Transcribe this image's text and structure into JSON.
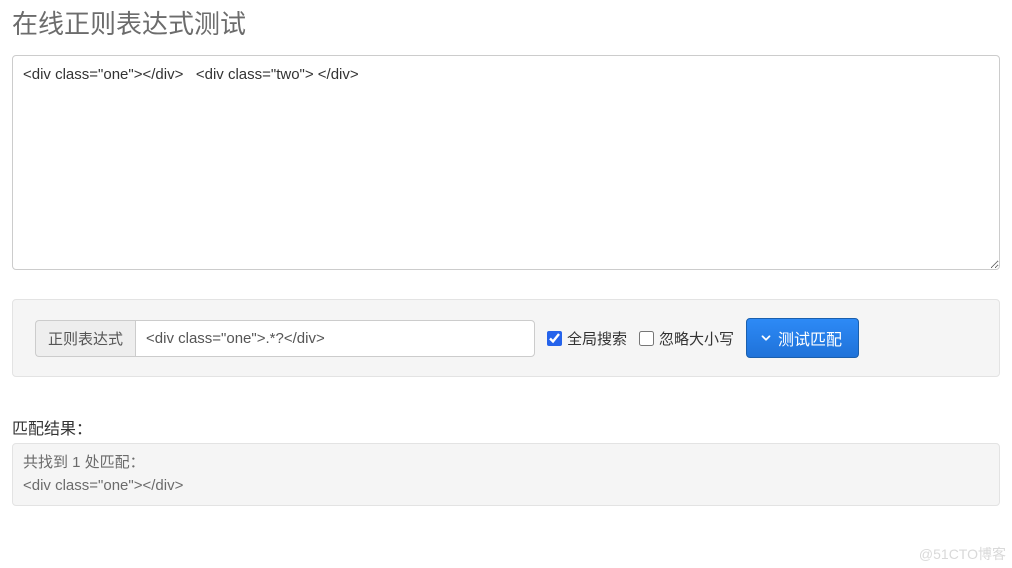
{
  "title": "在线正则表达式测试",
  "source_text": "<div class=\"one\"></div>   <div class=\"two\"> </div>",
  "regex": {
    "label": "正则表达式",
    "value": "<div class=\"one\">.*?</div>"
  },
  "options": {
    "global": {
      "label": "全局搜索",
      "checked": true
    },
    "ignorecase": {
      "label": "忽略大小写",
      "checked": false
    }
  },
  "actions": {
    "test_label": "测试匹配"
  },
  "results": {
    "heading": "匹配结果：",
    "summary": "共找到 1 处匹配：",
    "match": "<div class=\"one\"></div>"
  },
  "watermark": "@51CTO博客"
}
